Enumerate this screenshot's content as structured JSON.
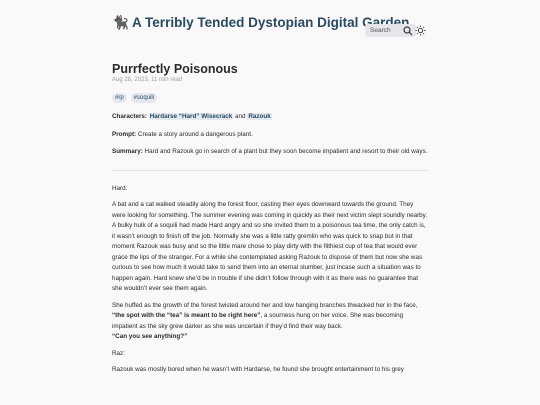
{
  "site": {
    "title": "🐈‍⬛ A Terribly Tended Dystopian Digital Garden",
    "search_label": "Search"
  },
  "post": {
    "title": "Purrfectly Poisonous",
    "meta": "Aug 28, 2023, 11 min read",
    "tags": [
      "#rp",
      "#soquili"
    ],
    "characters_label": "Characters:",
    "character_1": "Hardarse “Hard” Wisecrack",
    "character_and": "and",
    "character_2": "Razouk",
    "prompt_label": "Prompt:",
    "prompt_text": "Create a story around a dangerous plant.",
    "summary_label": "Summary:",
    "summary_text": "Hard and Razouk go in search of a plant but they soon become impatient and resort to their old ways."
  },
  "story": {
    "speaker_hard": "Hard:",
    "para1": "A bat and a cat walked steadily along the forest floor, casting their eyes downward towards the ground. They were looking for something. The summer evening was coming in quickly as their next victim slept soundly nearby.",
    "para2": "A bulky hulk of a soquili had made Hard angry and so she invited them to a poisonous tea time, the only catch is, it wasn’t enough to finish off the job. Normally she was a little ratty gremlin who was quick to snap but in that moment Razouk was busy and so the little mare chose to play dirty with the filthiest cup of tea that would ever grace the lips of the stranger. For a while she contemplated asking Razouk to dispose of them but now she was curious to see how much it would take to send them into an eternal slumber, just incase such a situation was to happen again. Hard knew she’d be in trouble if she didn’t follow through with it as there was no guarantee that she wouldn’t ever see them again.",
    "para3_a": "She huffed as the growth of the forest twisted around her and low hanging branches thwacked her in the face, ",
    "para3_quote": "“the spot with the “tea” is meant to be right here”",
    "para3_b": ", a sourness hung on her voice. She was becoming impatient as the sky grew darker as she was uncertain if they’d find their way back.",
    "para3_line": "“Can you see anything?”",
    "speaker_raz": "Raz:",
    "para4": "Razouk was mostly bored when he wasn’t with Hardarse, he found she brought entertainment to his grey"
  }
}
